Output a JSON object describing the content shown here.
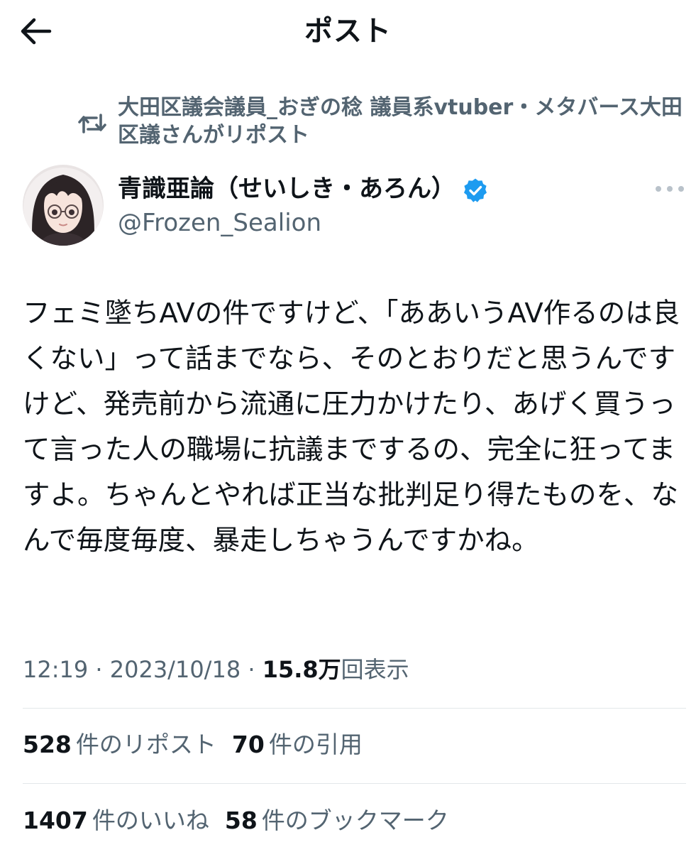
{
  "header": {
    "title": "ポスト",
    "back_icon": "arrow-left-icon"
  },
  "repost": {
    "icon": "repost-icon",
    "text": "大田区議会議員_おぎの稔 議員系vtuber・メタバース大田区議さんがリポスト"
  },
  "author": {
    "name": "青識亜論（せいしき・あろん）",
    "handle": "@Frozen_Sealion",
    "verified": true,
    "verified_color": "#1d9bf0"
  },
  "post": {
    "text": "フェミ墜ちAVの件ですけど、「ああいうAV作るのは良くない」って話までなら、そのとおりだと思うんですけど、発売前から流通に圧力かけたり、あげく買うって言った人の職場に抗議までするの、完全に狂ってますよ。ちゃんとやれば正当な批判足り得たものを、なんで毎度毎度、暴走しちゃうんですかね。"
  },
  "meta": {
    "time": "12:19",
    "sep1": " · ",
    "date": "2023/10/18",
    "sep2": " · ",
    "views_count": "15.8万",
    "views_label": "回表示"
  },
  "stats": {
    "reposts_count": "528",
    "reposts_label": "件のリポスト",
    "quotes_count": "70",
    "quotes_label": "件の引用",
    "likes_count": "1407",
    "likes_label": "件のいいね",
    "bookmarks_count": "58",
    "bookmarks_label": "件のブックマーク"
  },
  "colors": {
    "text_primary": "#0f1419",
    "text_secondary": "#536471",
    "divider": "#e3e7ea",
    "accent": "#1d9bf0"
  }
}
